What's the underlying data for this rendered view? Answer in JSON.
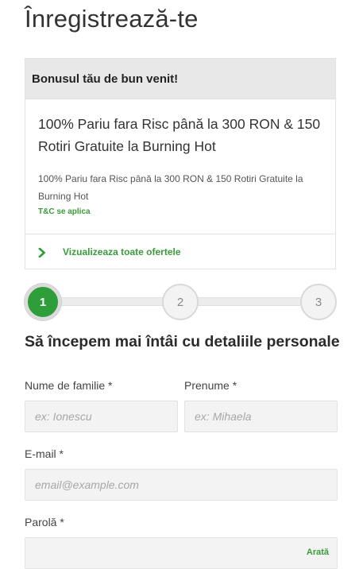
{
  "page": {
    "title": "Înregistrează-te"
  },
  "bonus": {
    "header": "Bonusul tău de bun venit!",
    "title": "100% Pariu fara Risc până la 300 RON & 150 Rotiri Gratuite la Burning Hot",
    "description": "100% Pariu fara Risc până la 300 RON & 150 Rotiri Gratuite la Burning Hot",
    "terms_link": "T&C se aplica",
    "view_all": "Vizualizeaza toate ofertele"
  },
  "stepper": {
    "steps": [
      "1",
      "2",
      "3"
    ],
    "active_step": 1
  },
  "form": {
    "heading": "Să începem mai întâi cu detaliile personale",
    "last_name": {
      "label": "Nume de familie *",
      "placeholder": "ex: Ionescu",
      "value": ""
    },
    "first_name": {
      "label": "Prenume *",
      "placeholder": "ex: Mihaela",
      "value": ""
    },
    "email": {
      "label": "E-mail *",
      "placeholder": "email@example.com",
      "value": ""
    },
    "password": {
      "label": "Parolă *",
      "placeholder": "",
      "value": "",
      "toggle_label": "Arată"
    }
  },
  "colors": {
    "accent": "#2e9e3a",
    "link": "#3a9b3a",
    "header_bg": "#e8e8e8",
    "input_bg": "#f3f3f3"
  },
  "icons": {
    "view_all": "chevron-right-icon"
  }
}
